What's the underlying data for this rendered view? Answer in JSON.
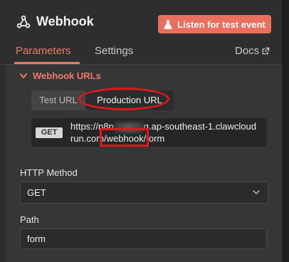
{
  "header": {
    "node_title": "Webhook",
    "listen_button": "Listen for test event"
  },
  "tabs": {
    "parameters": "Parameters",
    "settings": "Settings",
    "docs": "Docs"
  },
  "webhook_urls": {
    "section_label": "Webhook URLs",
    "test_url_label": "Test URL",
    "production_url_label": "Production URL",
    "method_badge": "GET",
    "url_line1_prefix": "https://n8n",
    "url_line1_suffix": "q.ap-southeast-1.clawcloud",
    "url_line2_prefix": "run.com",
    "url_line2_highlight": "/webhook/",
    "url_line2_suffix": "form"
  },
  "http_method": {
    "label": "HTTP Method",
    "value": "GET"
  },
  "path": {
    "label": "Path",
    "value": "form"
  },
  "colors": {
    "accent": "#ec7a66",
    "button": "#ea6f5c",
    "annotation": "#e0181c"
  }
}
